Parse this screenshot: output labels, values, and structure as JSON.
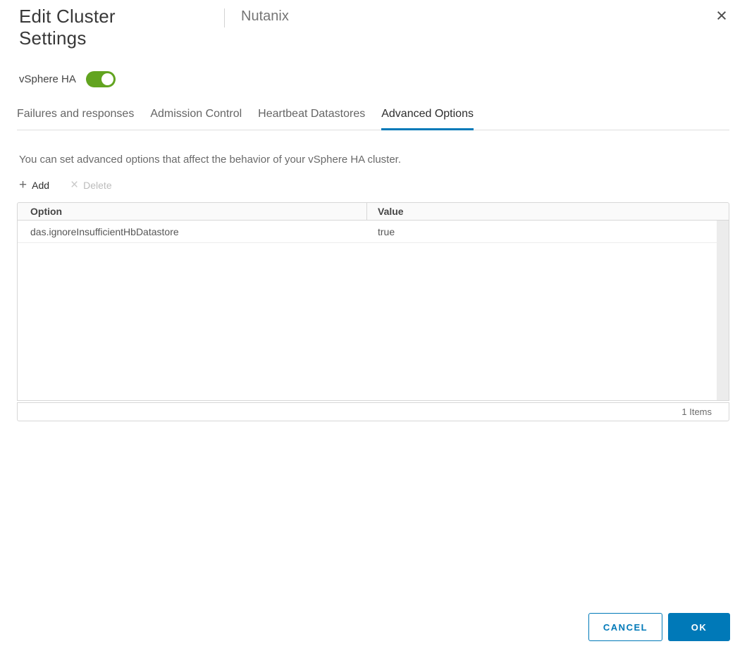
{
  "dialog": {
    "title_line1": "Edit Cluster",
    "title_line2": "Settings",
    "subtitle": "Nutanix",
    "close_glyph": "×"
  },
  "toggle": {
    "label": "vSphere HA",
    "state": "on"
  },
  "tabs": [
    {
      "label": "Failures and responses",
      "active": false
    },
    {
      "label": "Admission Control",
      "active": false
    },
    {
      "label": "Heartbeat Datastores",
      "active": false
    },
    {
      "label": "Advanced Options",
      "active": true
    }
  ],
  "description": "You can set advanced options that affect the behavior of your vSphere HA cluster.",
  "toolbar": {
    "add_icon": "+",
    "add_label": "Add",
    "delete_icon": "×",
    "delete_label": "Delete",
    "delete_enabled": false
  },
  "table": {
    "columns": [
      "Option",
      "Value"
    ],
    "rows": [
      {
        "option": "das.ignoreInsufficientHbDatastore",
        "value": "true"
      }
    ],
    "footer_count": "1 Items"
  },
  "actions": {
    "cancel_label": "CANCEL",
    "ok_label": "OK"
  },
  "colors": {
    "accent_blue": "#0079b8",
    "toggle_green": "#62a420",
    "border_gray": "#d7d7d7"
  }
}
